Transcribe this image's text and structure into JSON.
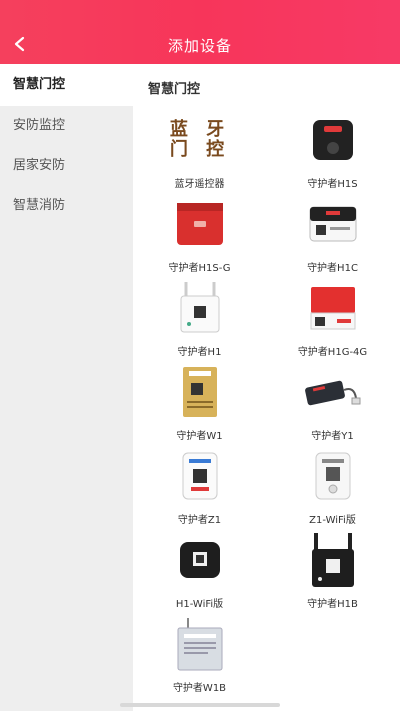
{
  "header": {
    "title": "添加设备",
    "back_icon": "chevron-left-icon"
  },
  "sidebar": {
    "items": [
      {
        "label": "智慧门控",
        "active": true
      },
      {
        "label": "安防监控",
        "active": false
      },
      {
        "label": "居家安防",
        "active": false
      },
      {
        "label": "智慧消防",
        "active": false
      }
    ]
  },
  "main": {
    "section_title": "智慧门控",
    "devices": [
      {
        "label": "蓝牙遥控器",
        "thumb_text": "蓝 牙 门 控"
      },
      {
        "label": "守护者H1S"
      },
      {
        "label": "守护者H1S-G"
      },
      {
        "label": "守护者H1C"
      },
      {
        "label": "守护者H1"
      },
      {
        "label": "守护者H1G-4G"
      },
      {
        "label": "守护者W1"
      },
      {
        "label": "守护者Y1"
      },
      {
        "label": "守护者Z1"
      },
      {
        "label": "Z1-WiFi版"
      },
      {
        "label": "H1-WiFi版"
      },
      {
        "label": "守护者H1B"
      },
      {
        "label": "守护者W1B"
      }
    ]
  },
  "colors": {
    "accent": "#f5405d",
    "sidebar_bg": "#eeeeee"
  }
}
